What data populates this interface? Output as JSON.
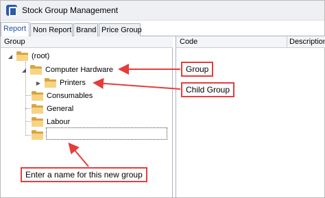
{
  "window": {
    "title": "Stock Group Management"
  },
  "tabs": [
    {
      "label": "Report",
      "active": true
    },
    {
      "label": "Non Report",
      "active": false
    },
    {
      "label": "Brand",
      "active": false
    },
    {
      "label": "Price Group",
      "active": false
    }
  ],
  "left_panel": {
    "header": "Group"
  },
  "tree": {
    "root": {
      "label": "(root)",
      "toggle": "◢"
    },
    "computer_hardware": {
      "label": "Computer Hardware",
      "toggle": "◢"
    },
    "printers": {
      "label": "Printers",
      "toggle": "▶"
    },
    "consumables": {
      "label": "Consumables"
    },
    "general": {
      "label": "General"
    },
    "labour": {
      "label": "Labour"
    },
    "new_group": {
      "label": ""
    }
  },
  "grid": {
    "columns": [
      "Code",
      "Description"
    ]
  },
  "callouts": {
    "group": "Group",
    "child_group": "Child Group",
    "new_group_hint": "Enter a name for this new group"
  },
  "colors": {
    "callout_red": "#e53c3c",
    "folder": "#f7d483",
    "tab_active_text": "#1f4fa0"
  }
}
